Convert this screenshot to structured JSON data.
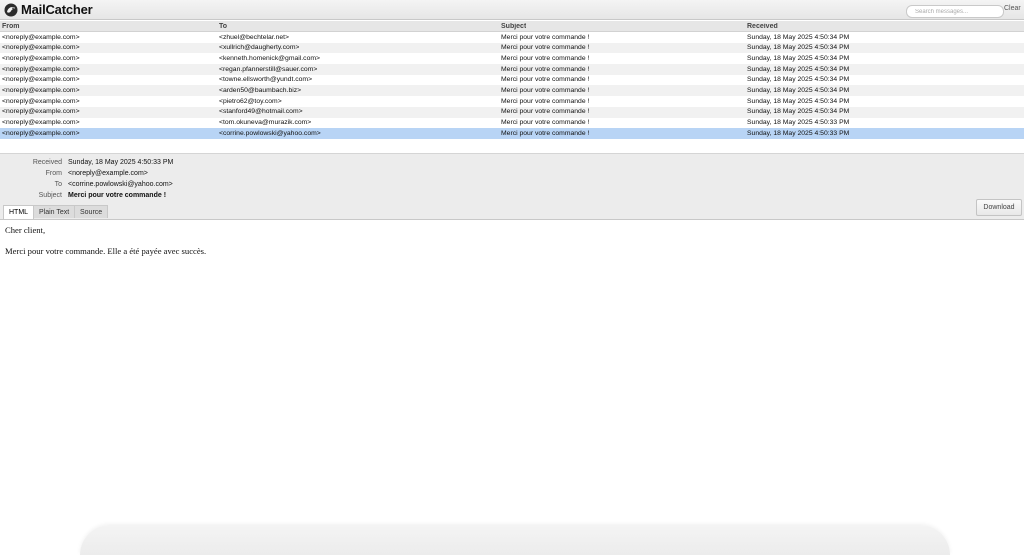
{
  "app": {
    "title": "MailCatcher"
  },
  "toolbar": {
    "search_placeholder": "Search messages...",
    "clear_label": "Clear"
  },
  "columns": {
    "from": "From",
    "to": "To",
    "subject": "Subject",
    "received": "Received"
  },
  "messages": [
    {
      "from": "<noreply@example.com>",
      "to": "<zhuel@bechtelar.net>",
      "subject": "Merci pour votre commande !",
      "received": "Sunday, 18 May 2025 4:50:34 PM"
    },
    {
      "from": "<noreply@example.com>",
      "to": "<xullrich@daugherty.com>",
      "subject": "Merci pour votre commande !",
      "received": "Sunday, 18 May 2025 4:50:34 PM"
    },
    {
      "from": "<noreply@example.com>",
      "to": "<kenneth.homenick@gmail.com>",
      "subject": "Merci pour votre commande !",
      "received": "Sunday, 18 May 2025 4:50:34 PM"
    },
    {
      "from": "<noreply@example.com>",
      "to": "<regan.pfannerstill@sauer.com>",
      "subject": "Merci pour votre commande !",
      "received": "Sunday, 18 May 2025 4:50:34 PM"
    },
    {
      "from": "<noreply@example.com>",
      "to": "<towne.ellsworth@yundt.com>",
      "subject": "Merci pour votre commande !",
      "received": "Sunday, 18 May 2025 4:50:34 PM"
    },
    {
      "from": "<noreply@example.com>",
      "to": "<arden50@baumbach.biz>",
      "subject": "Merci pour votre commande !",
      "received": "Sunday, 18 May 2025 4:50:34 PM"
    },
    {
      "from": "<noreply@example.com>",
      "to": "<pietro62@toy.com>",
      "subject": "Merci pour votre commande !",
      "received": "Sunday, 18 May 2025 4:50:34 PM"
    },
    {
      "from": "<noreply@example.com>",
      "to": "<stanford49@hotmail.com>",
      "subject": "Merci pour votre commande !",
      "received": "Sunday, 18 May 2025 4:50:34 PM"
    },
    {
      "from": "<noreply@example.com>",
      "to": "<tom.okuneva@murazik.com>",
      "subject": "Merci pour votre commande !",
      "received": "Sunday, 18 May 2025 4:50:33 PM"
    },
    {
      "from": "<noreply@example.com>",
      "to": "<corrine.powlowski@yahoo.com>",
      "subject": "Merci pour votre commande !",
      "received": "Sunday, 18 May 2025 4:50:33 PM"
    }
  ],
  "selected_index": 9,
  "detail": {
    "labels": {
      "received": "Received",
      "from": "From",
      "to": "To",
      "subject": "Subject"
    },
    "received": "Sunday, 18 May 2025 4:50:33 PM",
    "from": "<noreply@example.com>",
    "to": "<corrine.powlowski@yahoo.com>",
    "subject": "Merci pour votre commande !"
  },
  "tabs": [
    {
      "label": "HTML",
      "active": true
    },
    {
      "label": "Plain Text",
      "active": false
    },
    {
      "label": "Source",
      "active": false
    }
  ],
  "download_label": "Download",
  "body": {
    "greeting": "Cher client,",
    "text": "Merci pour votre commande. Elle a été payée avec succès."
  },
  "colors": {
    "selected_row": "#b8d4f5",
    "alt_row": "#f1f1f1",
    "header_bg": "#e6e6e6"
  }
}
